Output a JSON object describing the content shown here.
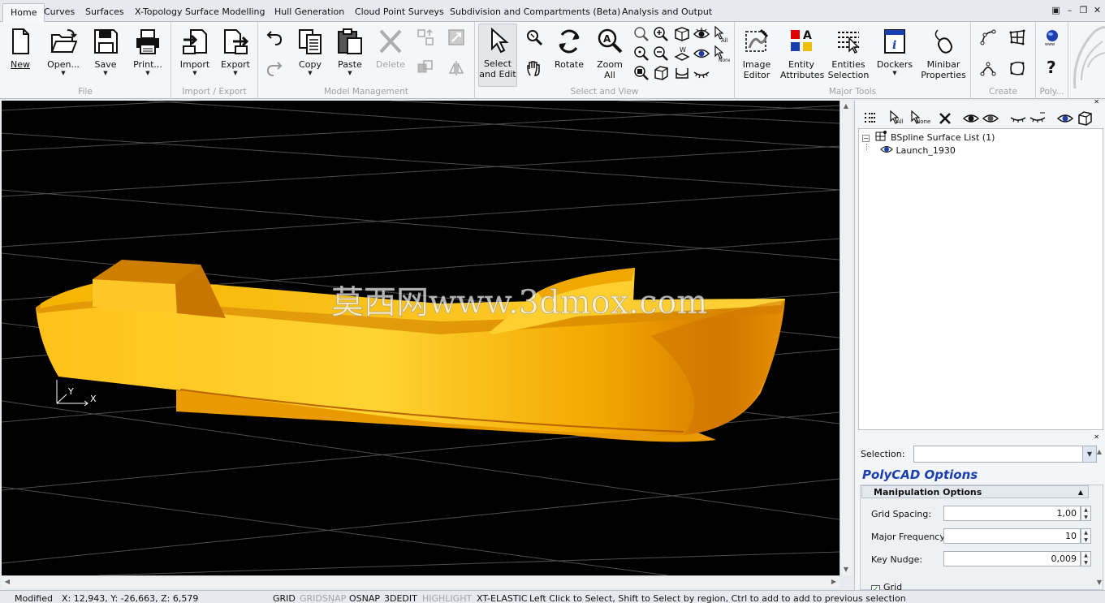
{
  "tabs": [
    {
      "label": "Home",
      "active": true
    },
    {
      "label": "Curves"
    },
    {
      "label": "Surfaces"
    },
    {
      "label": "X-Topology Surface Modelling"
    },
    {
      "label": "Hull Generation"
    },
    {
      "label": "Cloud Point Surveys"
    },
    {
      "label": "Subdivision and Compartments (Beta)"
    },
    {
      "label": "Analysis and Output"
    }
  ],
  "window_buttons": {
    "restore": "▣",
    "minimize": "–",
    "maximize": "❐",
    "close": "✕"
  },
  "ribbon": {
    "file": {
      "label": "File",
      "new": "New",
      "open": "Open...",
      "save": "Save",
      "print": "Print..."
    },
    "import_export": {
      "label": "Import / Export",
      "import": "Import",
      "export": "Export"
    },
    "model": {
      "label": "Model Management",
      "copy": "Copy",
      "paste": "Paste",
      "delete": "Delete"
    },
    "select_view": {
      "label": "Select and View",
      "select_line1": "Select",
      "select_line2": "and Edit",
      "rotate": "Rotate",
      "zoom_line1": "Zoom",
      "zoom_line2": "All"
    },
    "major_tools": {
      "label": "Major Tools",
      "image_line1": "Image",
      "image_line2": "Editor",
      "entity_line1": "Entity",
      "entity_line2": "Attributes",
      "entities_line1": "Entities",
      "entities_line2": "Selection",
      "dockers": "Dockers",
      "minibar_line1": "Minibar",
      "minibar_line2": "Properties"
    },
    "create": {
      "label": "Create"
    },
    "poly": {
      "label": "Poly..."
    }
  },
  "viewport": {
    "watermark": "莫西网www.3dmox.com",
    "axis_x": "X",
    "axis_y": "Y",
    "colors": {
      "background": "#000000",
      "hull": "#f5b400",
      "hull_dark": "#c97800",
      "grid": "#5a5a5a"
    }
  },
  "right_panel": {
    "toolbar_labels": {
      "all": "All",
      "none": "None"
    },
    "tree": {
      "root": "BSpline Surface List (1)",
      "child": "Launch_1930"
    },
    "selection_label": "Selection:",
    "selection_value": "",
    "options_title": "PolyCAD Options",
    "manipulation_header": "Manipulation Options",
    "fields": [
      {
        "label": "Grid Spacing:",
        "value": "1,00"
      },
      {
        "label": "Major Frequency:",
        "value": "10"
      },
      {
        "label": "Key Nudge:",
        "value": "0,009"
      }
    ],
    "grid_checkbox": {
      "label": "Grid",
      "checked": true
    }
  },
  "status": {
    "state": "Modified",
    "coords": "X:  12,943, Y:  -26,663, Z:   6,579",
    "grid": "GRID",
    "gridsnap": "GRIDSNAP",
    "osnap": "OSNAP",
    "edit3d": "3DEDIT",
    "highlight": "HIGHLIGHT",
    "elastic": "XT-ELASTIC",
    "hint": "Left Click to Select, Shift to Select by region, Ctrl to add to add to previous selection"
  }
}
